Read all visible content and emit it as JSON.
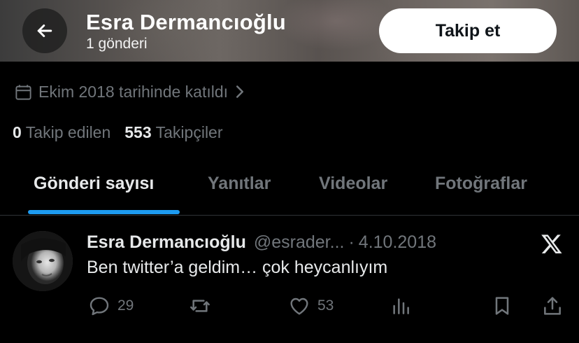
{
  "header": {
    "name": "Esra Dermancıoğlu",
    "post_count": "1 gönderi",
    "follow_label": "Takip et",
    "back_icon": "arrow-left-icon"
  },
  "profile": {
    "joined_text": "Ekim 2018 tarihinde katıldı",
    "joined_icon": "calendar-icon",
    "following_count": "0",
    "following_label": "Takip edilen",
    "followers_count": "553",
    "followers_label": "Takipçiler"
  },
  "tabs": [
    {
      "label": "Gönderi sayısı",
      "active": true
    },
    {
      "label": "Yanıtlar",
      "active": false
    },
    {
      "label": "Videolar",
      "active": false
    },
    {
      "label": "Fotoğraflar",
      "active": false
    }
  ],
  "tweet": {
    "name": "Esra Dermancıoğlu",
    "handle": "@esrader...",
    "separator": "·",
    "date": "4.10.2018",
    "text": "Ben twitter’a geldim… çok heycanlıyım",
    "source_icon": "x-logo-icon",
    "replies": "29",
    "retweets": "",
    "likes": "53"
  },
  "colors": {
    "accent": "#1d9bf0",
    "background": "#000000",
    "muted_text": "#71767b",
    "primary_text": "#e7e9ea"
  }
}
